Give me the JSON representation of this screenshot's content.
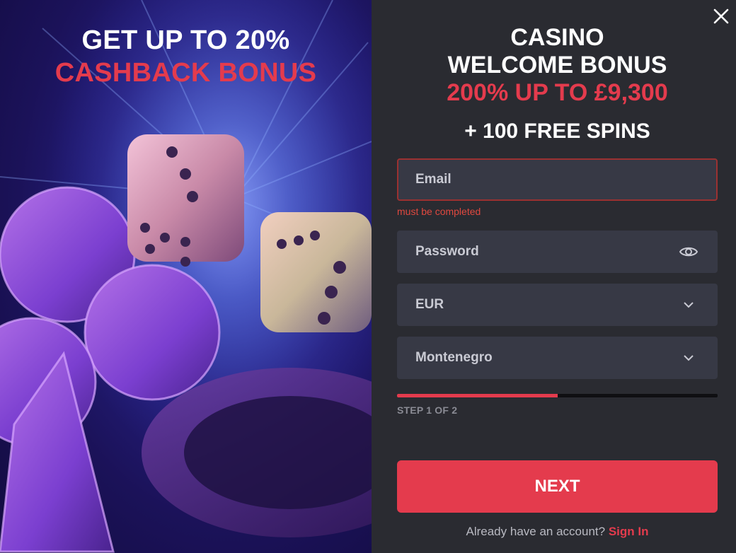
{
  "promo": {
    "line1": "GET UP TO 20%",
    "line2": "CASHBACK BONUS"
  },
  "offer": {
    "line1": "CASINO",
    "line2": "WELCOME BONUS",
    "line3": "200% UP TO £9,300",
    "line4": "+ 100 FREE SPINS"
  },
  "form": {
    "email": {
      "placeholder": "Email",
      "error": "must be completed"
    },
    "password": {
      "placeholder": "Password",
      "icon": "eye-icon"
    },
    "currency": {
      "value": "EUR",
      "icon": "chevron-down-icon"
    },
    "country": {
      "value": "Montenegro",
      "icon": "chevron-down-icon"
    },
    "progress": {
      "fraction": 0.5,
      "label": "STEP 1 OF 2"
    },
    "next_label": "NEXT",
    "account_prompt": "Already have an account?",
    "signin_label": "Sign In"
  },
  "colors": {
    "accent": "#e43b4d",
    "panel_bg": "#2a2b31",
    "field_bg": "#373945",
    "error": "#e0483f"
  }
}
